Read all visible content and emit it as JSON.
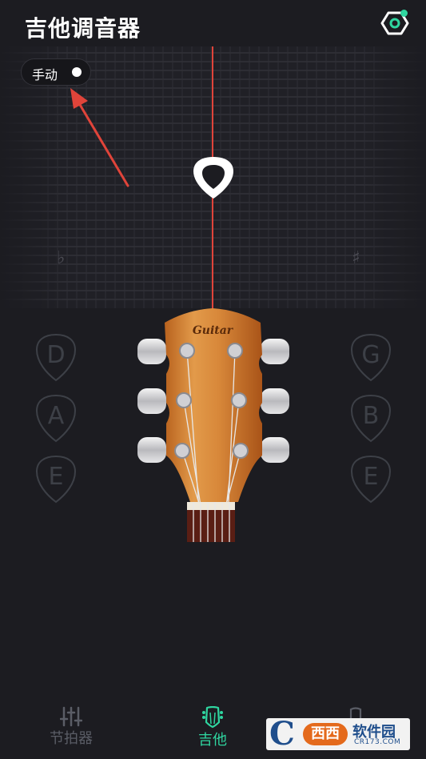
{
  "header": {
    "title": "吉他调音器"
  },
  "mode_toggle": {
    "label": "手动"
  },
  "tuner": {
    "flat_symbol": "♭",
    "sharp_symbol": "♯"
  },
  "strings": {
    "left": [
      "D",
      "A",
      "E"
    ],
    "right": [
      "G",
      "B",
      "E"
    ]
  },
  "headstock": {
    "brand": "Guitar"
  },
  "tabs": [
    {
      "label": "节拍器",
      "icon": "sliders-icon",
      "active": false
    },
    {
      "label": "吉他",
      "icon": "guitar-headstock-icon",
      "active": true
    },
    {
      "label": "",
      "icon": "ukulele-icon",
      "active": false
    }
  ],
  "watermark": {
    "brand_c": "C",
    "brand_xi": "西西",
    "name": "软件园",
    "url": "CR173.COM"
  },
  "colors": {
    "background": "#1c1c21",
    "accent": "#2fd6a0",
    "needle": "#e0443a",
    "settings_icon": "#2fd6a0",
    "arrow": "#e0443a",
    "inactive_tab": "#5a5d66"
  }
}
